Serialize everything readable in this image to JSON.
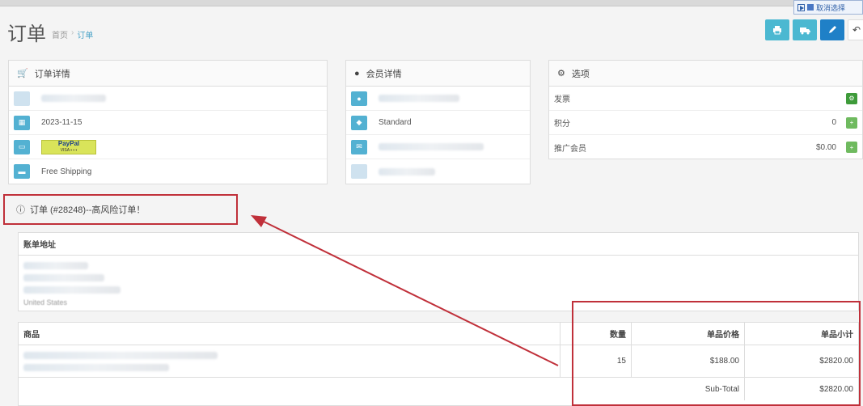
{
  "header": {
    "title": "订单",
    "breadcrumb": [
      "首页",
      "订单"
    ],
    "select_widget_label": "取消选择"
  },
  "actions": {
    "print_icon": "print-icon",
    "ship_icon": "truck-icon",
    "edit_icon": "pencil-icon",
    "back_icon": "reply-icon"
  },
  "order_details": {
    "title": "订单详情",
    "date": "2023-11-15",
    "payment_logo": "PayPal",
    "shipping": "Free Shipping"
  },
  "customer_details": {
    "title": "会员详情",
    "group": "Standard"
  },
  "options": {
    "title": "选项",
    "rows": [
      {
        "label": "发票",
        "value": ""
      },
      {
        "label": "积分",
        "value": "0"
      },
      {
        "label": "推广会员",
        "value": "$0.00"
      }
    ]
  },
  "alert": {
    "text": "订单 (#28248)--高风险订单！"
  },
  "billing": {
    "title": "账单地址",
    "country": "United States"
  },
  "items": {
    "headers": [
      "商品",
      "数量",
      "单品价格",
      "单品小计"
    ],
    "rows": [
      {
        "quantity": "15",
        "price": "$188.00",
        "total": "$2820.00"
      }
    ],
    "subtotal_label": "Sub-Total",
    "subtotal_value": "$2820.00"
  },
  "colors": {
    "accent": "#4bb8d1",
    "primary": "#1f80c7",
    "annotation": "#c0303a"
  }
}
